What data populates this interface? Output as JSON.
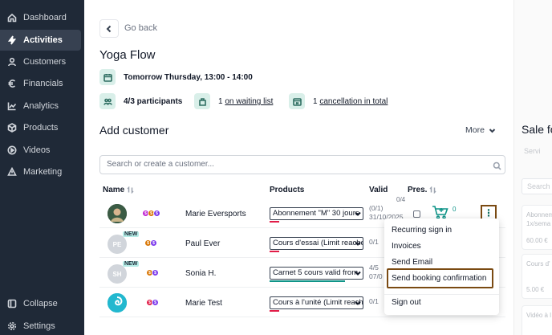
{
  "sidebar": {
    "items": [
      {
        "label": "Dashboard",
        "icon": "home-icon"
      },
      {
        "label": "Activities",
        "icon": "bolt-icon",
        "active": true
      },
      {
        "label": "Customers",
        "icon": "user-icon"
      },
      {
        "label": "Financials",
        "icon": "euro-icon"
      },
      {
        "label": "Analytics",
        "icon": "chart-icon"
      },
      {
        "label": "Products",
        "icon": "box-icon"
      },
      {
        "label": "Videos",
        "icon": "play-icon"
      },
      {
        "label": "Marketing",
        "icon": "megaphone-icon"
      }
    ],
    "footer": [
      {
        "label": "Collapse",
        "icon": "collapse-icon"
      },
      {
        "label": "Settings",
        "icon": "gear-icon"
      }
    ]
  },
  "header": {
    "back_label": "Go back",
    "title": "Yoga Flow",
    "datetime": "Tomorrow Thursday, 13:00 - 14:00",
    "participants": "4/3 participants",
    "waiting_count": "1",
    "waiting_label": "on waiting list",
    "cancellation_count": "1",
    "cancellation_label": "cancellation in total"
  },
  "add_customer": {
    "title": "Add customer",
    "more_label": "More",
    "search_placeholder": "Search or create a customer..."
  },
  "table": {
    "headers": {
      "name": "Name",
      "products": "Products",
      "valid": "Valid",
      "pres": "Pres."
    },
    "pres_count": "0/4",
    "rows": [
      {
        "name": "Marie Eversports",
        "initials": "",
        "badge": "",
        "product": "Abonnement \"M\" 30 jours",
        "valid_line1": "(0/1)",
        "valid_line2": "31/10/2025"
      },
      {
        "name": "Paul Ever",
        "initials": "PE",
        "badge": "NEW",
        "product": "Cours d'essai (Limit reached)",
        "valid_line1": "0/1",
        "valid_line2": ""
      },
      {
        "name": "Sonia H.",
        "initials": "SH",
        "badge": "NEW",
        "product": "Carnet 5 cours valid from",
        "valid_line1": "4/5",
        "valid_line2": "07/0"
      },
      {
        "name": "Marie Test",
        "initials": "",
        "badge": "",
        "product": "Cours à l'unité (Limit reached)",
        "valid_line1": "0/1",
        "valid_line2": ""
      }
    ],
    "cart_count": "0"
  },
  "context_menu": {
    "items": [
      "Recurring sign in",
      "Invoices",
      "Send Email",
      "Send booking confirmation",
      "Sign out"
    ]
  },
  "right_panel": {
    "title": "Sale fo",
    "tab": "Servi",
    "search": "Search",
    "cards": [
      {
        "line1": "Abonnem",
        "line2": "1x/sema",
        "price": "60.00 €"
      },
      {
        "line1": "Cours d'",
        "line2": "",
        "price": "5.00 €"
      },
      {
        "line1": "Vidéo à l",
        "line2": "",
        "price": ""
      }
    ]
  },
  "colors": {
    "sidebar_bg": "#1f2937",
    "accent_teal": "#0f9488",
    "highlight_brown": "#7a4a12"
  }
}
